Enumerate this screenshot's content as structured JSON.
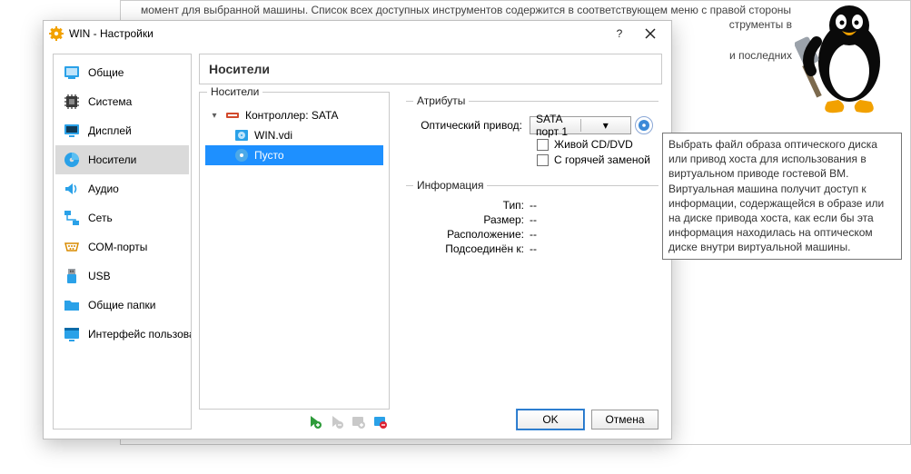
{
  "background": {
    "line1": "момент для выбранной машины. Список всех доступных инструментов содержится в соответствующем меню с правой стороны",
    "line1_tail": "струменты в",
    "line2_tail": "и последних"
  },
  "dialog": {
    "title": "WIN - Настройки",
    "page_title": "Носители",
    "sidebar": {
      "items": [
        {
          "label": "Общие"
        },
        {
          "label": "Система"
        },
        {
          "label": "Дисплей"
        },
        {
          "label": "Носители",
          "selected": true
        },
        {
          "label": "Аудио"
        },
        {
          "label": "Сеть"
        },
        {
          "label": "СОМ-порты"
        },
        {
          "label": "USB"
        },
        {
          "label": "Общие папки"
        },
        {
          "label": "Интерфейс пользователя"
        }
      ]
    },
    "carriers": {
      "legend": "Носители",
      "tree": [
        {
          "label": "Контроллер: SATA",
          "icon": "sata",
          "level": 0
        },
        {
          "label": "WIN.vdi",
          "icon": "disk",
          "level": 1
        },
        {
          "label": "Пусто",
          "icon": "cd",
          "level": 1,
          "selected": true
        }
      ]
    },
    "attrs": {
      "legend": "Атрибуты",
      "optical_label": "Оптический привод:",
      "optical_value": "SATA порт 1",
      "live_cd_label": "Живой CD/DVD",
      "hot_swap_label": "С горячей заменой"
    },
    "info": {
      "heading": "Информация",
      "type_label": "Тип:",
      "type_value": "--",
      "size_label": "Размер:",
      "size_value": "--",
      "loc_label": "Расположение:",
      "loc_value": "--",
      "att_label": "Подсоединён к:",
      "att_value": "--"
    },
    "buttons": {
      "ok": "OK",
      "cancel": "Отмена"
    }
  },
  "tooltip": "Выбрать файл образа оптического диска или привод хоста для использования в виртуальном приводе гостевой ВМ. Виртуальная машина получит доступ к информации, содержащейся в образе или на диске привода хоста, как если бы эта информация находилась на оптическом диске внутри виртуальной машины."
}
